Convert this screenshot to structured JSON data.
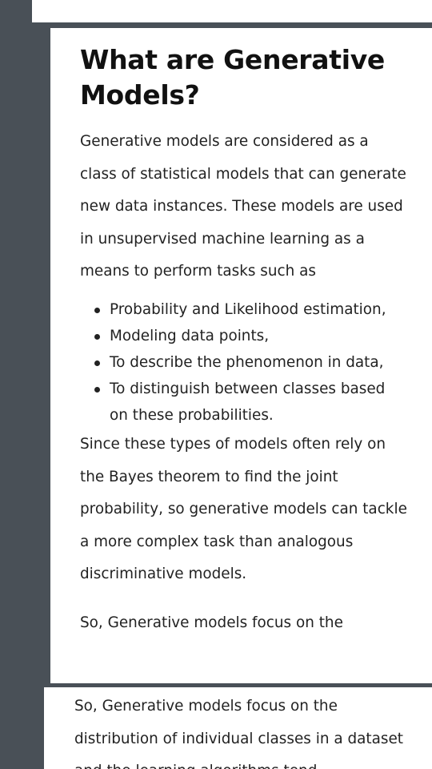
{
  "top_card": {
    "peek_text": "···"
  },
  "article": {
    "heading": "What are Generative Models?",
    "intro": "Generative models are considered as a class of statistical models that can generate new data instances. These models are used in unsupervised machine learning as a means to perform tasks such as",
    "bullets": [
      "Probability and Likelihood estimation,",
      "Modeling data points,",
      "To describe the phenomenon in data,",
      "To distinguish between classes based on these probabilities."
    ],
    "body": "Since these types of models often rely on the Bayes theorem to find the joint probability, so generative models can tackle a more complex task than analogous discriminative models.",
    "cutoff": "So, Generative models focus on the"
  },
  "bottom_card": {
    "text": "So, Generative models focus on the distribution of individual classes in a dataset and the learning algorithms tend"
  }
}
